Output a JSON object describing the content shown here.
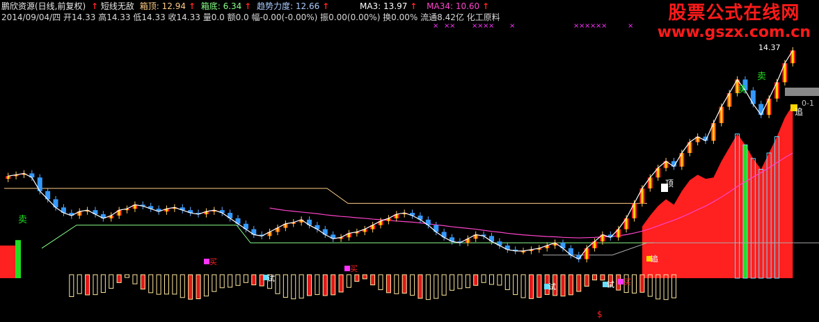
{
  "header": {
    "stock": "鹏欣资源(日线,前复权)",
    "indicator": "短线无敌",
    "box_top_label": "箱顶:",
    "box_top_value": "12.94",
    "box_bottom_label": "箱底:",
    "box_bottom_value": "6.34",
    "trend_label": "趋势力度:",
    "trend_value": "12.66",
    "ma3_label": "MA3:",
    "ma3_value": "13.97",
    "ma34_label": "MA34:",
    "ma34_value": "10.60",
    "quote_line": "2014/09/04/四 开14.33 高14.33 低14.33 收14.33 量0.0 额0.0 幅-0.00(-0.00%) 振0.00(0.00%) 换0.00% 流通8.42亿 化工原料",
    "arrow": "↑"
  },
  "watermark": {
    "title": "股票公式在线网",
    "url": "www.gszx.com.cn"
  },
  "price_label": "14.37",
  "right_tick": "0-1",
  "signals": {
    "sell": "卖",
    "buy": "买",
    "try": "试",
    "top": "顶",
    "chase": "追",
    "dollar": "$",
    "cross": "×"
  },
  "colors": {
    "background": "#000000",
    "up": "#ff2020",
    "down": "#3399ff",
    "yellow": "#ffd700",
    "white_line": "#ffffff",
    "ma34": "#ff44cc",
    "box_top_line": "#ffcc88",
    "box_bottom_line": "#88ff88",
    "magenta": "#ff33ff",
    "green_signal": "#22dd22",
    "cyan": "#66ddff"
  },
  "chart_data": {
    "type": "candlestick",
    "ylim": [
      6.0,
      15.2
    ],
    "close": [
      9.75,
      9.8,
      9.85,
      9.7,
      9.2,
      8.9,
      8.6,
      8.4,
      8.3,
      8.45,
      8.5,
      8.35,
      8.2,
      8.3,
      8.5,
      8.55,
      8.7,
      8.65,
      8.55,
      8.45,
      8.55,
      8.6,
      8.5,
      8.4,
      8.35,
      8.45,
      8.5,
      8.4,
      8.2,
      8.0,
      7.8,
      7.6,
      7.55,
      7.7,
      7.85,
      8.0,
      8.05,
      8.15,
      7.95,
      7.8,
      7.6,
      7.45,
      7.5,
      7.65,
      7.7,
      7.8,
      7.95,
      8.1,
      8.2,
      8.35,
      8.4,
      8.3,
      8.15,
      7.95,
      7.7,
      7.5,
      7.35,
      7.3,
      7.45,
      7.6,
      7.55,
      7.35,
      7.2,
      7.05,
      7.0,
      7.0,
      7.05,
      7.1,
      7.2,
      7.3,
      7.1,
      6.85,
      6.7,
      7.1,
      7.35,
      7.6,
      7.5,
      7.8,
      8.2,
      8.75,
      9.3,
      9.7,
      10.05,
      10.3,
      10.1,
      10.6,
      11.0,
      11.2,
      11.05,
      11.7,
      12.3,
      12.8,
      13.3,
      12.9,
      12.4,
      12.0,
      12.6,
      13.2,
      13.9,
      14.37
    ],
    "ma34": [
      null,
      null,
      null,
      null,
      null,
      null,
      null,
      null,
      null,
      null,
      null,
      null,
      null,
      null,
      null,
      null,
      null,
      null,
      null,
      null,
      null,
      null,
      null,
      null,
      null,
      null,
      null,
      null,
      null,
      null,
      null,
      null,
      null,
      8.58,
      8.53,
      8.49,
      8.46,
      8.43,
      8.4,
      8.37,
      8.33,
      8.3,
      8.27,
      8.25,
      8.22,
      8.2,
      8.17,
      8.15,
      8.12,
      8.1,
      8.08,
      8.06,
      8.03,
      8.0,
      7.96,
      7.93,
      7.89,
      7.86,
      7.83,
      7.8,
      7.76,
      7.72,
      7.69,
      7.65,
      7.62,
      7.59,
      7.57,
      7.55,
      7.53,
      7.52,
      7.5,
      7.49,
      7.48,
      7.49,
      7.5,
      7.52,
      7.53,
      7.56,
      7.6,
      7.66,
      7.73,
      7.82,
      7.92,
      8.03,
      8.13,
      8.25,
      8.38,
      8.52,
      8.65,
      8.81,
      8.98,
      9.17,
      9.37,
      9.55,
      9.72,
      9.88,
      10.06,
      10.25,
      10.43,
      10.6
    ],
    "box_top": [
      9.5,
      9.5,
      9.5,
      9.5,
      9.5,
      9.5,
      9.5,
      9.5,
      9.5,
      9.5,
      9.5,
      9.5,
      9.5,
      9.5,
      9.5,
      9.5,
      9.5,
      9.5,
      9.5,
      9.5,
      9.5,
      9.5,
      9.5,
      9.5,
      9.5,
      9.5,
      9.5,
      9.5,
      9.5,
      9.5,
      9.5,
      9.5,
      9.5,
      9.5,
      9.5,
      9.5,
      9.5,
      9.5,
      9.5,
      9.5,
      9.5,
      9.5,
      9.5,
      9.5,
      9.5,
      9.5,
      9.5,
      9.5,
      9.5,
      9.5,
      9.5,
      9.5,
      9.5,
      9.5,
      9.5,
      9.5,
      9.5,
      9.5,
      9.5,
      9.5,
      9.5,
      9.5,
      9.5,
      9.5,
      9.5,
      9.5,
      9.5,
      9.5,
      9.5,
      9.5,
      9.5,
      9.5,
      9.5,
      9.5,
      9.5,
      9.5,
      9.5,
      9.5,
      9.5,
      9.5,
      9.5,
      9.5,
      9.5,
      9.5,
      9.5,
      9.5,
      9.5,
      9.5,
      9.5,
      9.5,
      9.5,
      9.5,
      9.5,
      9.5,
      9.5,
      9.5,
      9.5,
      9.5,
      9.5,
      9.5
    ]
  }
}
